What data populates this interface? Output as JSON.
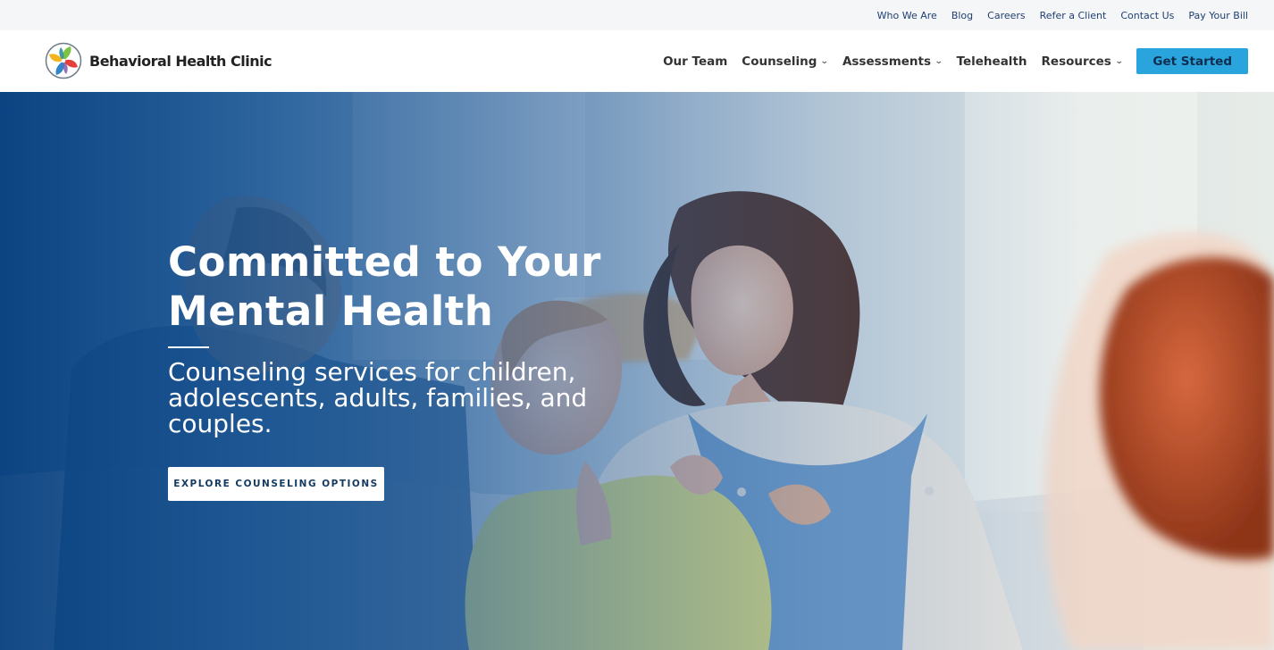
{
  "top_bar": {
    "links": [
      "Who We Are",
      "Blog",
      "Careers",
      "Refer a Client",
      "Contact Us",
      "Pay Your Bill"
    ]
  },
  "header": {
    "brand_name": "Behavioral Health Clinic",
    "nav": {
      "our_team": "Our Team",
      "counseling": "Counseling",
      "assessments": "Assessments",
      "telehealth": "Telehealth",
      "resources": "Resources"
    },
    "cta_label": "Get Started"
  },
  "hero": {
    "title_line1": "Committed to Your",
    "title_line2": "Mental Health",
    "subtitle": "Counseling services for children, adolescents, adults, families, and couples.",
    "button_label": "EXPLORE COUNSELING OPTIONS"
  },
  "icons": {
    "logo": "pinwheel-logo-icon",
    "dropdown": "chevron-down-icon"
  },
  "colors": {
    "primary_blue": "#064284",
    "accent_cyan": "#2aa4dc",
    "top_bar_bg": "#f5f6f8",
    "link_navy": "#1f3f73"
  }
}
